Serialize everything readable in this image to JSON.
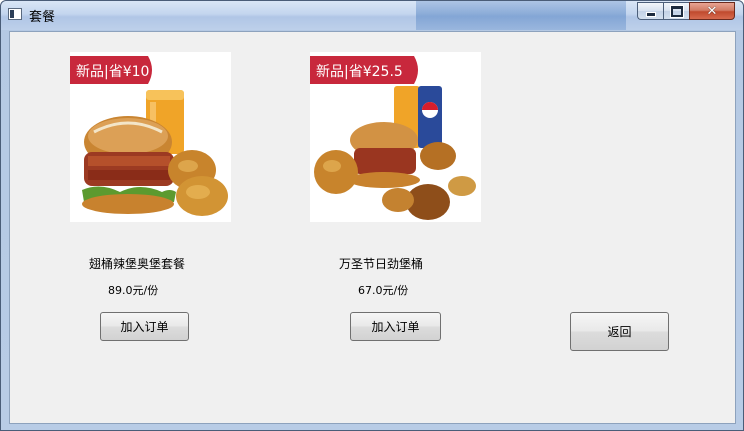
{
  "window": {
    "title": "套餐"
  },
  "products": [
    {
      "name": "翅桶辣堡奥堡套餐",
      "price": "89.0元/份",
      "badge_text": "新品|省¥10",
      "button_label": "加入订单"
    },
    {
      "name": "万圣节日劲堡桶",
      "price": "67.0元/份",
      "badge_text": "新品|省¥25.5",
      "button_label": "加入订单"
    }
  ],
  "back_button_label": "返回",
  "colors": {
    "badge": "#c8283c",
    "client_bg": "#f0f0f0",
    "close_button": "#c04a2e"
  }
}
